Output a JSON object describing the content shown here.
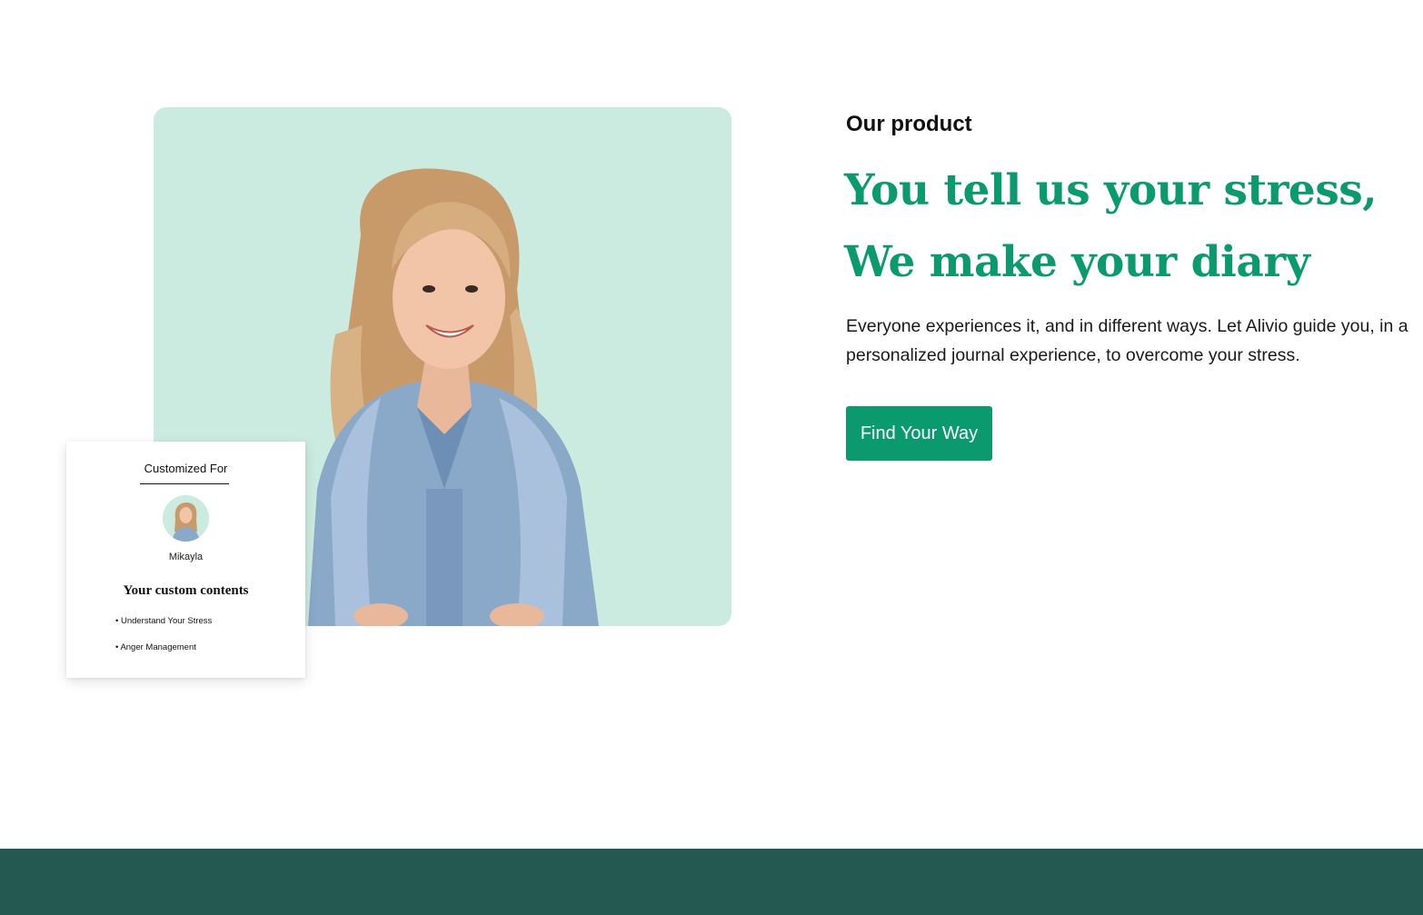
{
  "product_section": {
    "eyebrow": "Our product",
    "headline_line1": "You tell us your stress,",
    "headline_line2": "We make your diary",
    "description": "Everyone experiences it, and in different ways. Let Alivio guide you, in a personalized journal experience, to overcome your stress.",
    "cta_label": "Find Your Way"
  },
  "custom_card": {
    "title": "Customized For",
    "name": "Mikayla",
    "heading": "Your custom contents",
    "items": [
      "• Understand Your Stress",
      "• Anger Management"
    ]
  },
  "colors": {
    "accent": "#0a9a6e",
    "photo_background": "#ccebe0",
    "footer_band": "#245952"
  },
  "icons": {
    "avatar": "user-avatar-photo",
    "hero_photo": "smiling-woman-denim-jacket"
  }
}
